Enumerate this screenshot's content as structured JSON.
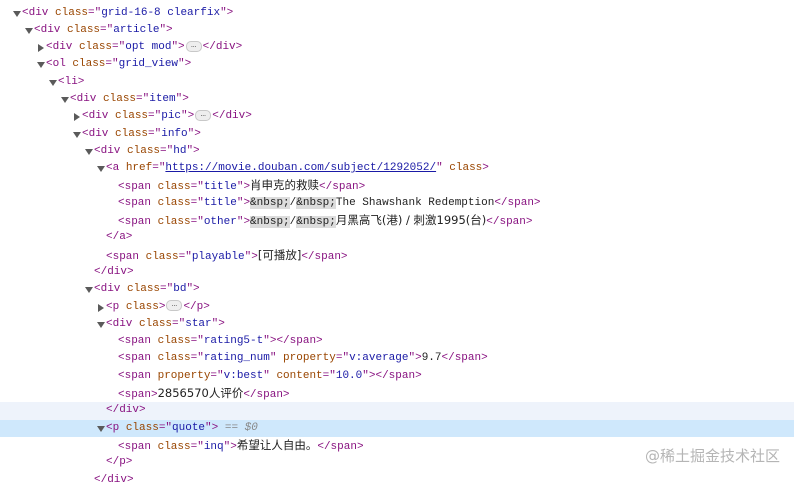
{
  "colors": {
    "tag": "#881280",
    "attr_name": "#994500",
    "attr_value": "#1a1aa6",
    "selected_bg": "#cfe8fc",
    "hover_bg": "#eef3fb"
  },
  "lines": [
    {
      "level": 0,
      "toggle": "open",
      "tokens": [
        [
          "t",
          "<div "
        ],
        [
          "an",
          "class"
        ],
        [
          "t",
          "=\""
        ],
        [
          "av",
          "grid-16-8 clearfix"
        ],
        [
          "t",
          "\">"
        ]
      ]
    },
    {
      "level": 1,
      "toggle": "open",
      "tokens": [
        [
          "t",
          "<div "
        ],
        [
          "an",
          "class"
        ],
        [
          "t",
          "=\""
        ],
        [
          "av",
          "article"
        ],
        [
          "t",
          "\">"
        ]
      ]
    },
    {
      "level": 2,
      "toggle": "closed",
      "tokens": [
        [
          "t",
          "<div "
        ],
        [
          "an",
          "class"
        ],
        [
          "t",
          "=\""
        ],
        [
          "av",
          "opt mod"
        ],
        [
          "t",
          "\">"
        ],
        [
          "ell",
          "…"
        ],
        [
          "t",
          "</div>"
        ]
      ]
    },
    {
      "level": 2,
      "toggle": "open",
      "tokens": [
        [
          "t",
          "<ol "
        ],
        [
          "an",
          "class"
        ],
        [
          "t",
          "=\""
        ],
        [
          "av",
          "grid_view"
        ],
        [
          "t",
          "\">"
        ]
      ]
    },
    {
      "level": 3,
      "toggle": "open",
      "tokens": [
        [
          "t",
          "<li>"
        ]
      ]
    },
    {
      "level": 4,
      "toggle": "open",
      "tokens": [
        [
          "t",
          "<div "
        ],
        [
          "an",
          "class"
        ],
        [
          "t",
          "=\""
        ],
        [
          "av",
          "item"
        ],
        [
          "t",
          "\">"
        ]
      ]
    },
    {
      "level": 5,
      "toggle": "closed",
      "tokens": [
        [
          "t",
          "<div "
        ],
        [
          "an",
          "class"
        ],
        [
          "t",
          "=\""
        ],
        [
          "av",
          "pic"
        ],
        [
          "t",
          "\">"
        ],
        [
          "ell",
          "…"
        ],
        [
          "t",
          "</div>"
        ]
      ]
    },
    {
      "level": 5,
      "toggle": "open",
      "tokens": [
        [
          "t",
          "<div "
        ],
        [
          "an",
          "class"
        ],
        [
          "t",
          "=\""
        ],
        [
          "av",
          "info"
        ],
        [
          "t",
          "\">"
        ]
      ]
    },
    {
      "level": 6,
      "toggle": "open",
      "tokens": [
        [
          "t",
          "<div "
        ],
        [
          "an",
          "class"
        ],
        [
          "t",
          "=\""
        ],
        [
          "av",
          "hd"
        ],
        [
          "t",
          "\">"
        ]
      ]
    },
    {
      "level": 7,
      "toggle": "open",
      "tokens": [
        [
          "t",
          "<a "
        ],
        [
          "an",
          "href"
        ],
        [
          "t",
          "=\""
        ],
        [
          "lk",
          "https://movie.douban.com/subject/1292052/"
        ],
        [
          "t",
          "\" "
        ],
        [
          "an",
          "class"
        ],
        [
          "t",
          ">"
        ]
      ]
    },
    {
      "level": 8,
      "toggle": "none",
      "tokens": [
        [
          "t",
          "<span "
        ],
        [
          "an",
          "class"
        ],
        [
          "t",
          "=\""
        ],
        [
          "av",
          "title"
        ],
        [
          "t",
          "\">"
        ],
        [
          "tx",
          "肖申克的救赎"
        ],
        [
          "t",
          "</span>"
        ]
      ]
    },
    {
      "level": 8,
      "toggle": "none",
      "tokens": [
        [
          "t",
          "<span "
        ],
        [
          "an",
          "class"
        ],
        [
          "t",
          "=\""
        ],
        [
          "av",
          "title"
        ],
        [
          "t",
          "\">"
        ],
        [
          "nb",
          "&nbsp;"
        ],
        [
          "tx2",
          "/"
        ],
        [
          "nb",
          "&nbsp;"
        ],
        [
          "tx2",
          "The Shawshank Redemption"
        ],
        [
          "t",
          "</span>"
        ]
      ]
    },
    {
      "level": 8,
      "toggle": "none",
      "tokens": [
        [
          "t",
          "<span "
        ],
        [
          "an",
          "class"
        ],
        [
          "t",
          "=\""
        ],
        [
          "av",
          "other"
        ],
        [
          "t",
          "\">"
        ],
        [
          "nb",
          "&nbsp;"
        ],
        [
          "tx2",
          "/"
        ],
        [
          "nb",
          "&nbsp;"
        ],
        [
          "tx",
          "月黑高飞(港) / 刺激1995(台)"
        ],
        [
          "t",
          "</span>"
        ]
      ]
    },
    {
      "level": 7,
      "toggle": "none",
      "tokens": [
        [
          "t",
          "</a>"
        ]
      ]
    },
    {
      "level": 7,
      "toggle": "none",
      "tokens": [
        [
          "t",
          "<span "
        ],
        [
          "an",
          "class"
        ],
        [
          "t",
          "=\""
        ],
        [
          "av",
          "playable"
        ],
        [
          "t",
          "\">"
        ],
        [
          "tx",
          "[可播放]"
        ],
        [
          "t",
          "</span>"
        ]
      ]
    },
    {
      "level": 6,
      "toggle": "none",
      "tokens": [
        [
          "t",
          "</div>"
        ]
      ]
    },
    {
      "level": 6,
      "toggle": "open",
      "tokens": [
        [
          "t",
          "<div "
        ],
        [
          "an",
          "class"
        ],
        [
          "t",
          "=\""
        ],
        [
          "av",
          "bd"
        ],
        [
          "t",
          "\">"
        ]
      ]
    },
    {
      "level": 7,
      "toggle": "closed",
      "tokens": [
        [
          "t",
          "<p "
        ],
        [
          "an",
          "class"
        ],
        [
          "t",
          ">"
        ],
        [
          "ell",
          "…"
        ],
        [
          "t",
          "</p>"
        ]
      ]
    },
    {
      "level": 7,
      "toggle": "open",
      "tokens": [
        [
          "t",
          "<div "
        ],
        [
          "an",
          "class"
        ],
        [
          "t",
          "=\""
        ],
        [
          "av",
          "star"
        ],
        [
          "t",
          "\">"
        ]
      ]
    },
    {
      "level": 8,
      "toggle": "none",
      "tokens": [
        [
          "t",
          "<span "
        ],
        [
          "an",
          "class"
        ],
        [
          "t",
          "=\""
        ],
        [
          "av",
          "rating5-t"
        ],
        [
          "t",
          "\"></span>"
        ]
      ]
    },
    {
      "level": 8,
      "toggle": "none",
      "tokens": [
        [
          "t",
          "<span "
        ],
        [
          "an",
          "class"
        ],
        [
          "t",
          "=\""
        ],
        [
          "av",
          "rating_num"
        ],
        [
          "t",
          "\" "
        ],
        [
          "an",
          "property"
        ],
        [
          "t",
          "=\""
        ],
        [
          "av",
          "v:average"
        ],
        [
          "t",
          "\">"
        ],
        [
          "tx2",
          "9.7"
        ],
        [
          "t",
          "</span>"
        ]
      ]
    },
    {
      "level": 8,
      "toggle": "none",
      "tokens": [
        [
          "t",
          "<span "
        ],
        [
          "an",
          "property"
        ],
        [
          "t",
          "=\""
        ],
        [
          "av",
          "v:best"
        ],
        [
          "t",
          "\" "
        ],
        [
          "an",
          "content"
        ],
        [
          "t",
          "=\""
        ],
        [
          "av",
          "10.0"
        ],
        [
          "t",
          "\"></span>"
        ]
      ]
    },
    {
      "level": 8,
      "toggle": "none",
      "tokens": [
        [
          "t",
          "<span>"
        ],
        [
          "tx",
          "2856570人评价"
        ],
        [
          "t",
          "</span>"
        ]
      ]
    },
    {
      "level": 7,
      "toggle": "none",
      "state": "hover",
      "tokens": [
        [
          "t",
          "</div>"
        ]
      ]
    },
    {
      "level": 7,
      "toggle": "open",
      "state": "selected",
      "tokens": [
        [
          "t",
          "<p "
        ],
        [
          "an",
          "class"
        ],
        [
          "t",
          "=\""
        ],
        [
          "av",
          "quote"
        ],
        [
          "t",
          "\">"
        ],
        [
          "eq",
          " == $0"
        ]
      ]
    },
    {
      "level": 8,
      "toggle": "none",
      "tokens": [
        [
          "t",
          "<span "
        ],
        [
          "an",
          "class"
        ],
        [
          "t",
          "=\""
        ],
        [
          "av",
          "inq"
        ],
        [
          "t",
          "\">"
        ],
        [
          "tx",
          "希望让人自由。"
        ],
        [
          "t",
          "</span>"
        ]
      ]
    },
    {
      "level": 7,
      "toggle": "none",
      "tokens": [
        [
          "t",
          "</p>"
        ]
      ]
    },
    {
      "level": 6,
      "toggle": "none",
      "tokens": [
        [
          "t",
          "</div>"
        ]
      ]
    }
  ],
  "watermark": "@稀土掘金技术社区"
}
